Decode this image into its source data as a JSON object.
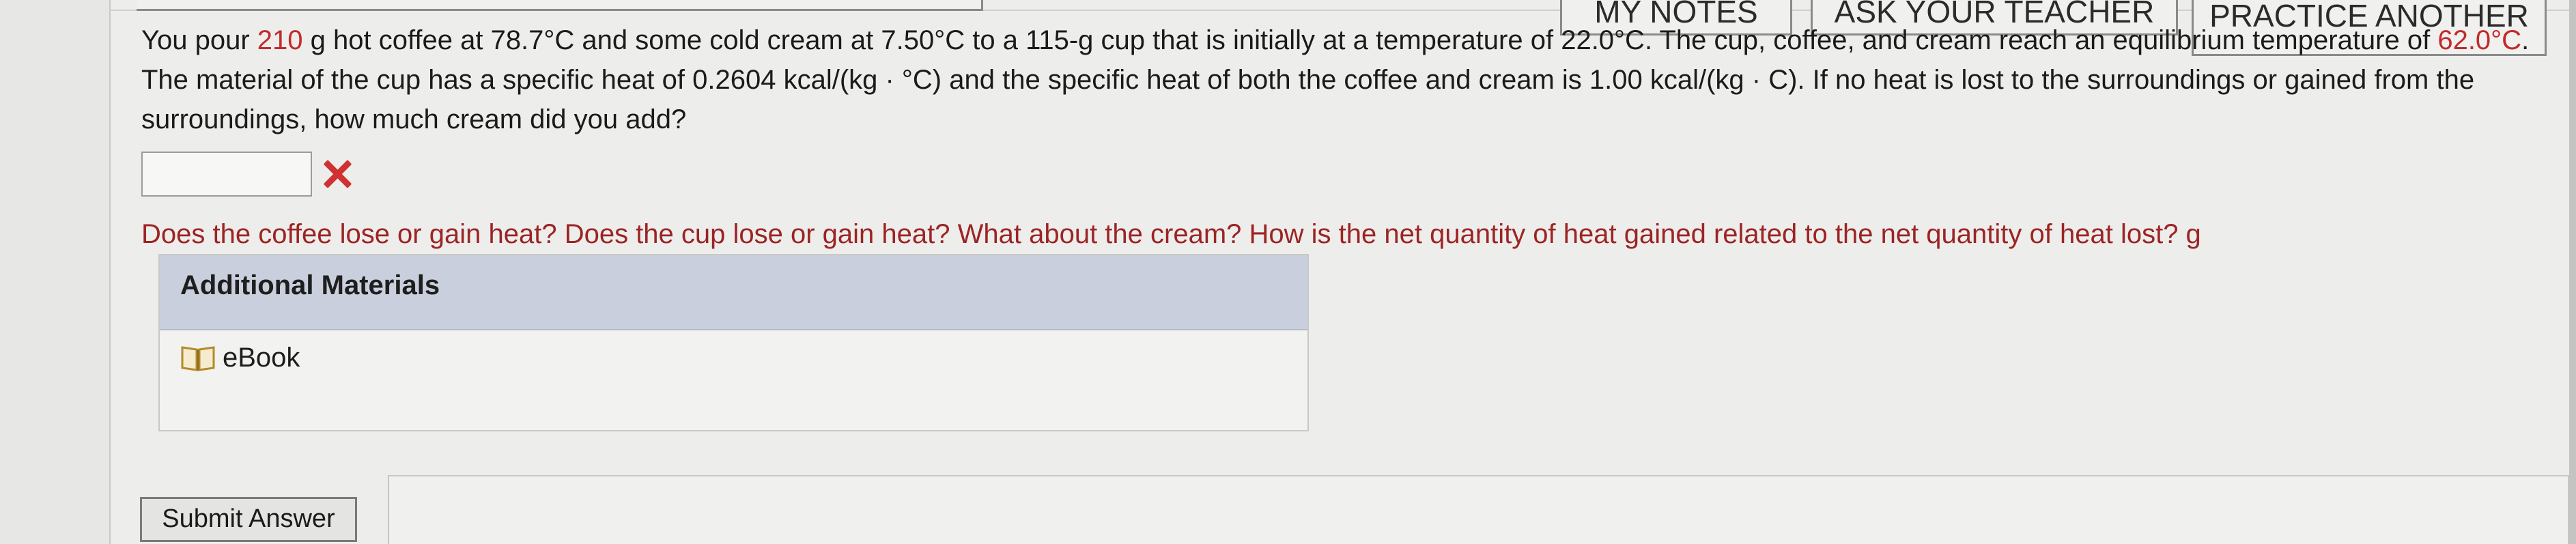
{
  "top_buttons": {
    "notes_label": "MY NOTES",
    "ask_label": "ASK YOUR TEACHER",
    "practice_label": "PRACTICE ANOTHER"
  },
  "question": {
    "part1": "You pour ",
    "coffee_mass": "210",
    "part2": " g hot coffee at 78.7°C and some cold cream at 7.50°C to a 115-g cup that is initially at a temperature of 22.0°C. The cup, coffee, and cream reach an equilibrium temperature of ",
    "equilibrium_temp": "62.0°C",
    "part3": ". The material of the cup has a specific heat of 0.2604 kcal/(kg · °C) and the specific heat of both the coffee and cream is 1.00 kcal/(kg · C). If no heat is lost to the surroundings or gained from the surroundings, how much cream did you add?"
  },
  "answer": {
    "value": "",
    "status": "incorrect",
    "colors": {
      "incorrect": "#cf3232"
    }
  },
  "hint": {
    "text": "Does the coffee lose or gain heat? Does the cup lose or gain heat? What about the cream? How is the net quantity of heat gained related to the net quantity of heat lost? g"
  },
  "additional_materials": {
    "title": "Additional Materials",
    "items": [
      {
        "label": "eBook",
        "icon": "book-icon"
      }
    ]
  },
  "submit": {
    "label": "Submit Answer"
  }
}
